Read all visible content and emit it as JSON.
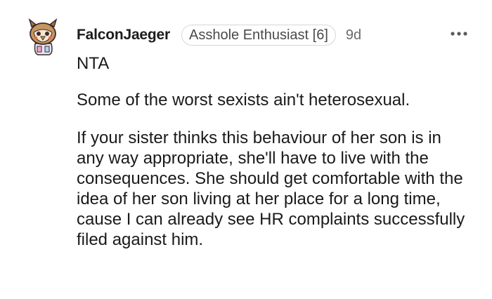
{
  "comment": {
    "username": "FalconJaeger",
    "flair": "Asshole Enthusiast [6]",
    "age": "9d",
    "more_icon": "more-horizontal-icon",
    "avatar_icon": "snoo-avatar-icon",
    "paragraphs": [
      "NTA",
      "Some of the worst sexists ain't heterosexual.",
      "If your sister thinks this behaviour of her son is in any way appropriate, she'll have to live with the consequences. She should get comfortable with the idea of her son living at her place for a long time, cause I can already see HR complaints successfully filed against him."
    ]
  },
  "colors": {
    "text": "#1a1a1b",
    "muted": "#6b6b6b",
    "flair_border": "#d7d7d7"
  }
}
